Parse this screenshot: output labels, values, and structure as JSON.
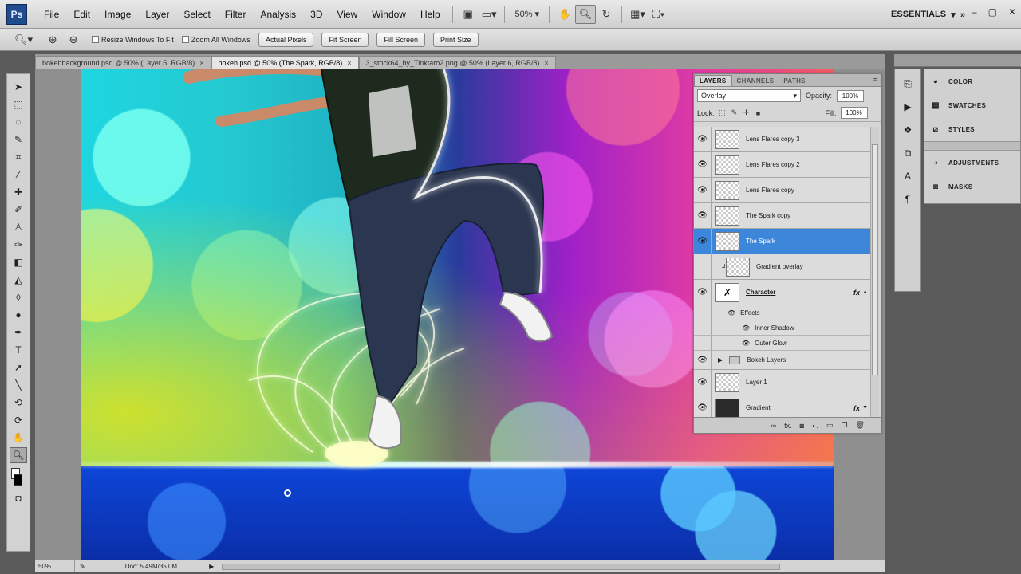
{
  "menubar": {
    "logo": "Ps",
    "menus": [
      "File",
      "Edit",
      "Image",
      "Layer",
      "Select",
      "Filter",
      "Analysis",
      "3D",
      "View",
      "Window",
      "Help"
    ],
    "zoom": "50%",
    "workspace": "ESSENTIALS"
  },
  "options": {
    "resize_windows": "Resize Windows To Fit",
    "zoom_all_windows": "Zoom All Windows",
    "actual_pixels": "Actual Pixels",
    "fit_screen": "Fit Screen",
    "fill_screen": "Fill Screen",
    "print_size": "Print Size"
  },
  "tabs": [
    {
      "label": "bokehbackground.psd @ 50% (Layer 5, RGB/8)",
      "active": false
    },
    {
      "label": "bokeh.psd @ 50% (The Spark, RGB/8)",
      "active": true
    },
    {
      "label": "3_stock64_by_Tinktaro2.png @ 50% (Layer 6, RGB/8)",
      "active": false
    }
  ],
  "status": {
    "zoom": "50%",
    "doc": "Doc: 5.49M/35.0M"
  },
  "layers_panel": {
    "tabs": [
      "LAYERS",
      "CHANNELS",
      "PATHS"
    ],
    "blend_mode": "Overlay",
    "opacity_label": "Opacity:",
    "opacity": "100%",
    "lock_label": "Lock:",
    "fill_label": "Fill:",
    "fill": "100%",
    "layers": [
      {
        "name": "Lens Flares copy 3"
      },
      {
        "name": "Lens Flares copy 2"
      },
      {
        "name": "Lens Flares copy"
      },
      {
        "name": "The Spark copy"
      },
      {
        "name": "The Spark"
      },
      {
        "name": "Gradient overlay"
      },
      {
        "name": "Character"
      },
      {
        "name": "Effects"
      },
      {
        "name": "Inner Shadow"
      },
      {
        "name": "Outer Glow"
      },
      {
        "name": "Bokeh Layers"
      },
      {
        "name": "Layer 1"
      },
      {
        "name": "Gradient"
      }
    ]
  },
  "dock": {
    "panels": [
      "COLOR",
      "SWATCHES",
      "STYLES",
      "ADJUSTMENTS",
      "MASKS"
    ]
  }
}
